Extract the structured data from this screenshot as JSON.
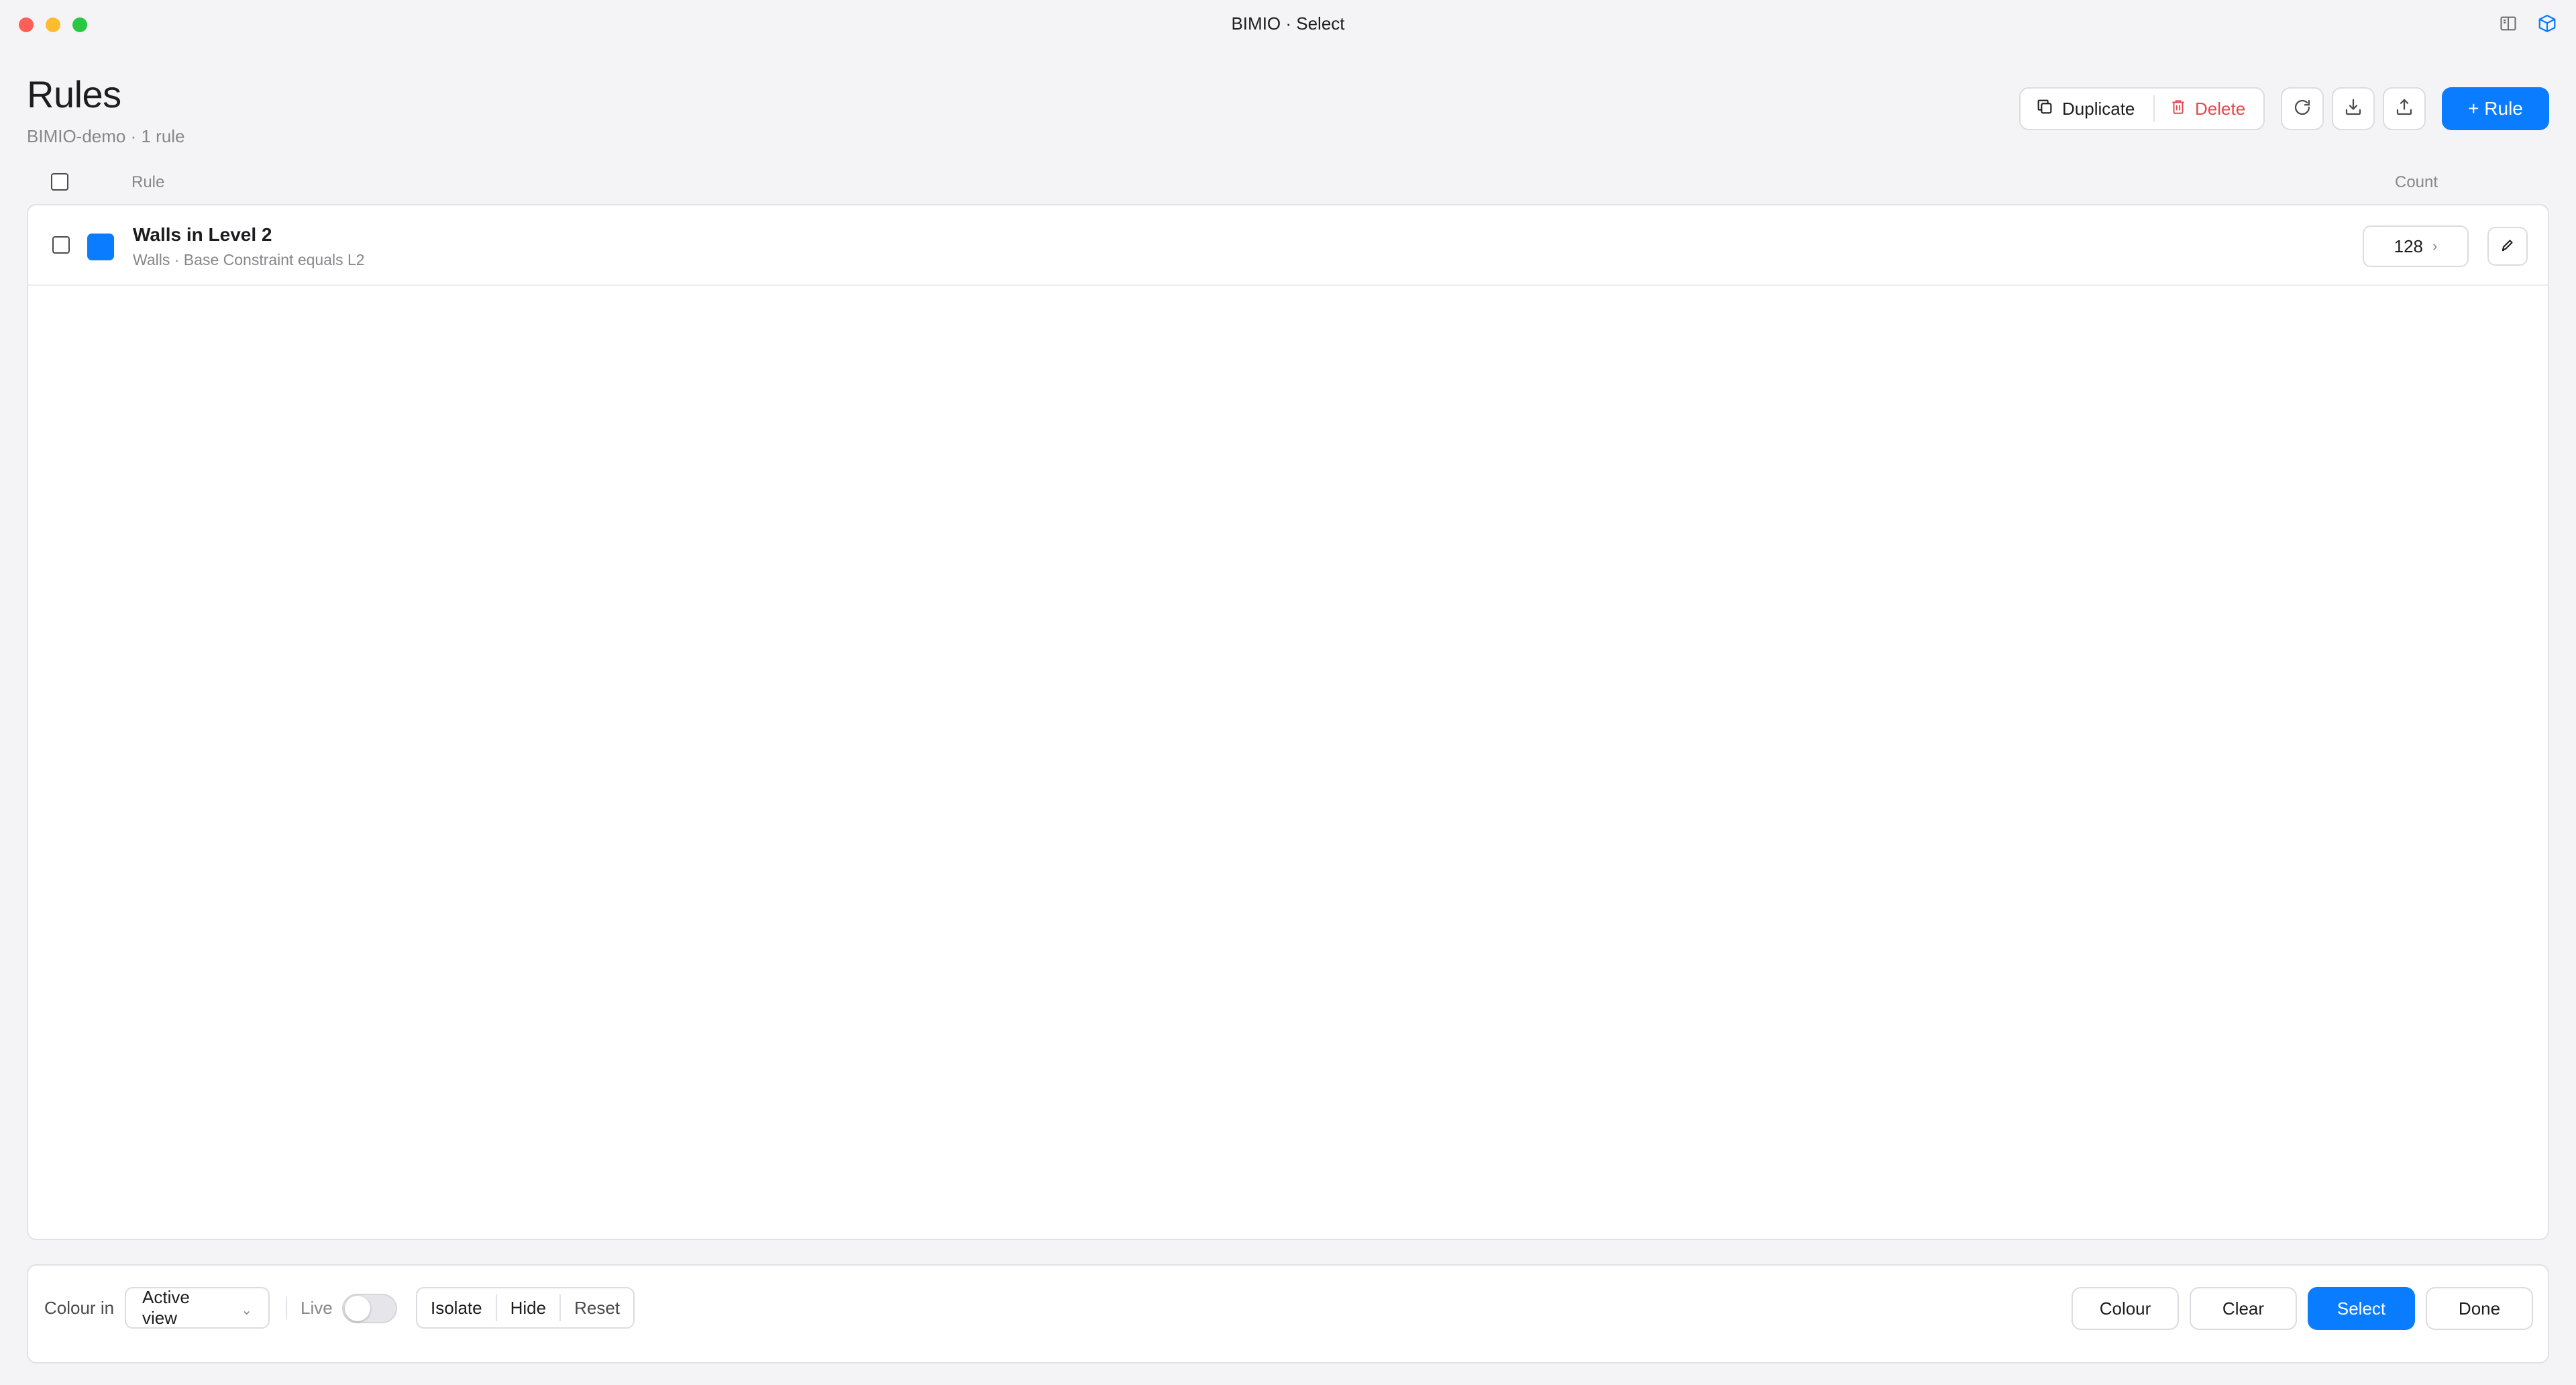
{
  "window": {
    "title": "BIMIO · Select"
  },
  "header": {
    "title": "Rules",
    "subtitle": "BIMIO-demo · 1 rule"
  },
  "toolbar": {
    "duplicate_label": "Duplicate",
    "delete_label": "Delete",
    "add_rule_label": "+ Rule",
    "delete_color": "#e5484d",
    "accent_color": "#0a7cff"
  },
  "table": {
    "columns": {
      "rule": "Rule",
      "count": "Count"
    },
    "rows": [
      {
        "name": "Walls in Level 2",
        "description": "Walls · Base Constraint equals L2",
        "color": "#0a7cff",
        "count": "128",
        "checked": false
      }
    ]
  },
  "bottom_bar": {
    "colour_in_label": "Colour in",
    "colour_in_value": "Active view",
    "live_label": "Live",
    "live_on": false,
    "isolate_label": "Isolate",
    "hide_label": "Hide",
    "reset_label": "Reset",
    "colour_button": "Colour",
    "clear_button": "Clear",
    "select_button": "Select",
    "done_button": "Done"
  },
  "icons": {
    "titlebar_right": [
      "book-icon",
      "cube-icon"
    ],
    "toolbar": [
      "duplicate-icon",
      "trash-icon",
      "refresh-icon",
      "download-icon",
      "upload-icon"
    ],
    "row": [
      "pencil-icon",
      "chevron-right-icon"
    ]
  }
}
